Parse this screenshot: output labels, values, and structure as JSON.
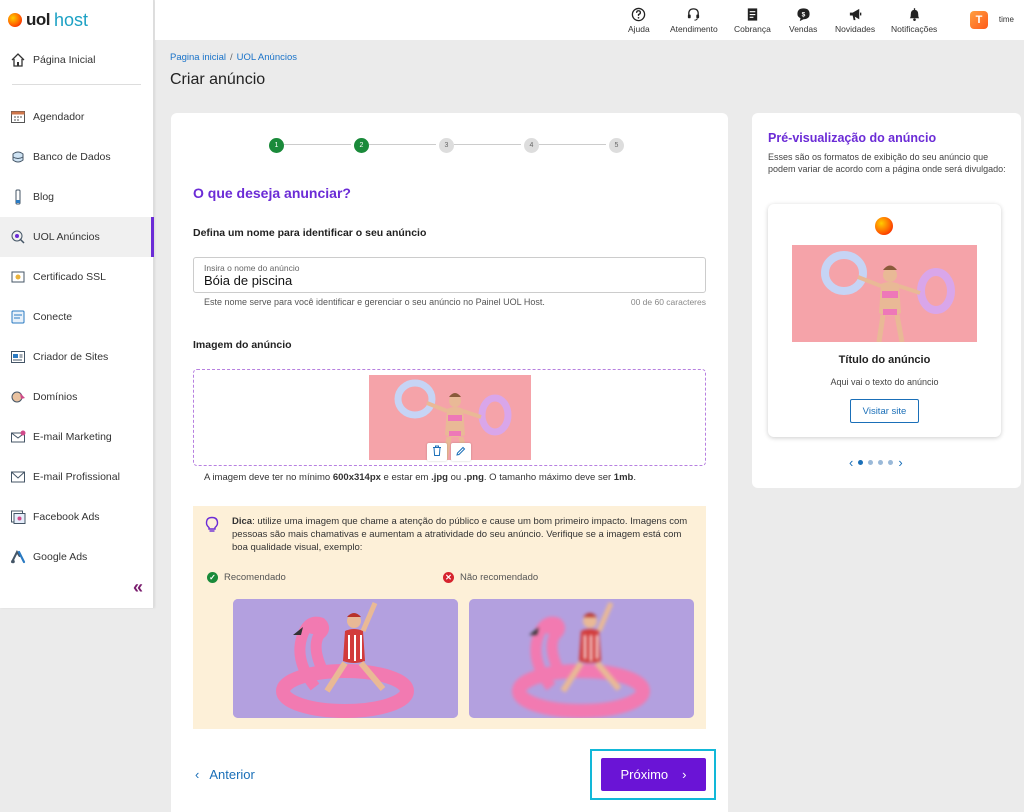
{
  "brand": {
    "uol": "uol",
    "host": "host"
  },
  "sidebar": {
    "items": [
      {
        "label": "Página Inicial",
        "icon": "home-icon"
      },
      {
        "label": "Agendador",
        "icon": "calendar-icon"
      },
      {
        "label": "Banco de Dados",
        "icon": "database-icon"
      },
      {
        "label": "Blog",
        "icon": "blog-icon"
      },
      {
        "label": "UOL Anúncios",
        "icon": "ads-icon",
        "active": true
      },
      {
        "label": "Certificado SSL",
        "icon": "ssl-icon"
      },
      {
        "label": "Conecte",
        "icon": "connect-icon"
      },
      {
        "label": "Criador de Sites",
        "icon": "site-builder-icon"
      },
      {
        "label": "Domínios",
        "icon": "domain-icon"
      },
      {
        "label": "E-mail Marketing",
        "icon": "email-marketing-icon"
      },
      {
        "label": "E-mail Profissional",
        "icon": "email-pro-icon"
      },
      {
        "label": "Facebook Ads",
        "icon": "facebook-ads-icon"
      },
      {
        "label": "Google Ads",
        "icon": "google-ads-icon"
      }
    ],
    "collapse_glyph": "«"
  },
  "topbar": {
    "items": [
      {
        "label": "Ajuda",
        "icon": "help-icon"
      },
      {
        "label": "Atendimento",
        "icon": "headset-icon"
      },
      {
        "label": "Cobrança",
        "icon": "billing-icon"
      },
      {
        "label": "Vendas",
        "icon": "sales-icon"
      },
      {
        "label": "Novidades",
        "icon": "megaphone-icon"
      },
      {
        "label": "Notificações",
        "icon": "bell-icon"
      }
    ],
    "avatar_initial": "T",
    "avatar_label": "time"
  },
  "breadcrumb": {
    "home": "Pagina inicial",
    "sep": "/",
    "current": "UOL Anúncios"
  },
  "page_title": "Criar anúncio",
  "stepper": {
    "steps": [
      "1",
      "2",
      "3",
      "4",
      "5"
    ],
    "completed": 2
  },
  "form": {
    "section_title": "O que deseja anunciar?",
    "name_label": "Defina um nome para identificar o seu anúncio",
    "name_placeholder": "Insira o nome do anúncio",
    "name_value": "Bóia de piscina",
    "name_helper": "Este nome serve para você identificar e gerenciar o seu anúncio no Painel UOL Host.",
    "name_counter": "00 de 60 caracteres",
    "image_label": "Imagem do anúncio",
    "image_note_1": "A imagem deve ter no mínimo ",
    "image_note_size": "600x314px",
    "image_note_2": " e estar em ",
    "image_note_jpg": ".jpg",
    "image_note_3": " ou ",
    "image_note_png": ".png",
    "image_note_4": ". O tamanho máximo deve ser ",
    "image_note_max": "1mb",
    "image_note_5": "."
  },
  "tip": {
    "bold": "Dica",
    "text": ": utilize uma imagem que chame a atenção do público e cause um bom primeiro impacto. Imagens com pessoas são mais chamativas e aumentam a atratividade do seu anúncio. Verifique se a imagem está com boa qualidade visual, exemplo:",
    "recommended": "Recomendado",
    "not_recommended": "Não recomendado"
  },
  "nav": {
    "prev": "Anterior",
    "next": "Próximo",
    "prev_glyph": "‹",
    "next_glyph": "›"
  },
  "preview": {
    "title": "Pré-visualização do anúncio",
    "desc": "Esses são os formatos de exibição do seu anúncio que podem variar de acordo com a página onde será divulgado:",
    "ad_title": "Título do anúncio",
    "ad_text": "Aqui vai o texto do anúncio",
    "visit": "Visitar site",
    "dots": 4,
    "active_dot": 1
  },
  "colors": {
    "accent": "#6a14d6",
    "link": "#1a6fb8",
    "success": "#1a8a3a",
    "danger": "#d6232e"
  }
}
